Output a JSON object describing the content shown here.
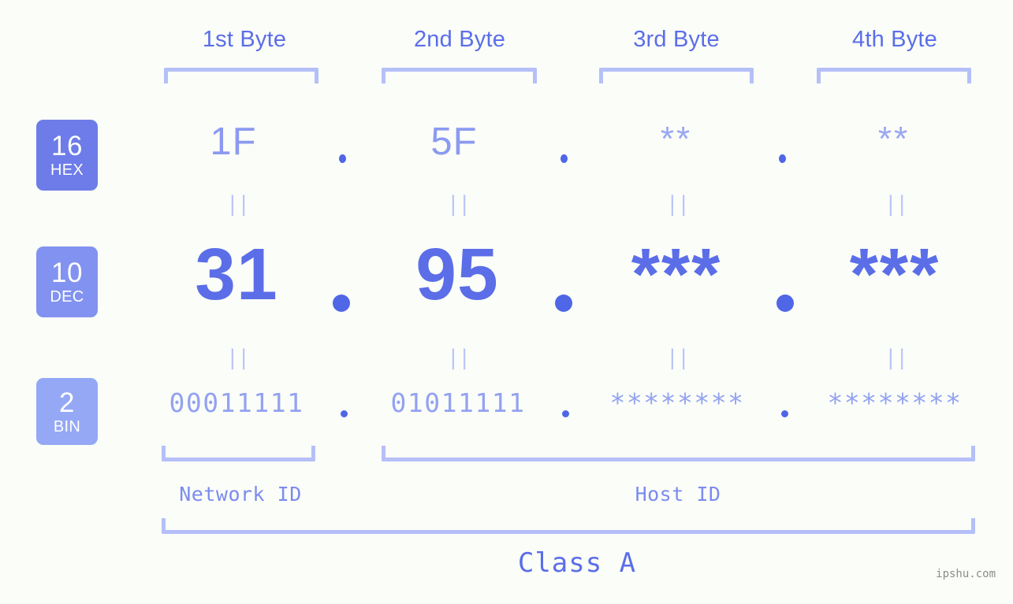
{
  "watermark": "ipshu.com",
  "header": {
    "byte_labels": [
      "1st Byte",
      "2nd Byte",
      "3rd Byte",
      "4th Byte"
    ]
  },
  "colors": {
    "background": "#fbfdf9",
    "bracket": "#b5c0f8",
    "accent_strong": "#5b6ee8",
    "accent_light": "#8b9af0",
    "dot": "#4f66e6",
    "badge_hex": "#6d7ce8",
    "badge_dec": "#8292f0",
    "badge_bin": "#94a8f5",
    "watermark": "#8c8c8c"
  },
  "badges": [
    {
      "num": "16",
      "label": "HEX"
    },
    {
      "num": "10",
      "label": "DEC"
    },
    {
      "num": "2",
      "label": "BIN"
    }
  ],
  "rows": {
    "hex": {
      "bytes": [
        "1F",
        "5F",
        "**",
        "**"
      ],
      "separator": "."
    },
    "dec": {
      "bytes": [
        "31",
        "95",
        "***",
        "***"
      ],
      "separator": "."
    },
    "bin": {
      "bytes": [
        "00011111",
        "01011111",
        "********",
        "********"
      ],
      "separator": "."
    }
  },
  "equals_marker": "||",
  "footer": {
    "network_id_label": "Network ID",
    "host_id_label": "Host ID",
    "class_label": "Class A"
  }
}
